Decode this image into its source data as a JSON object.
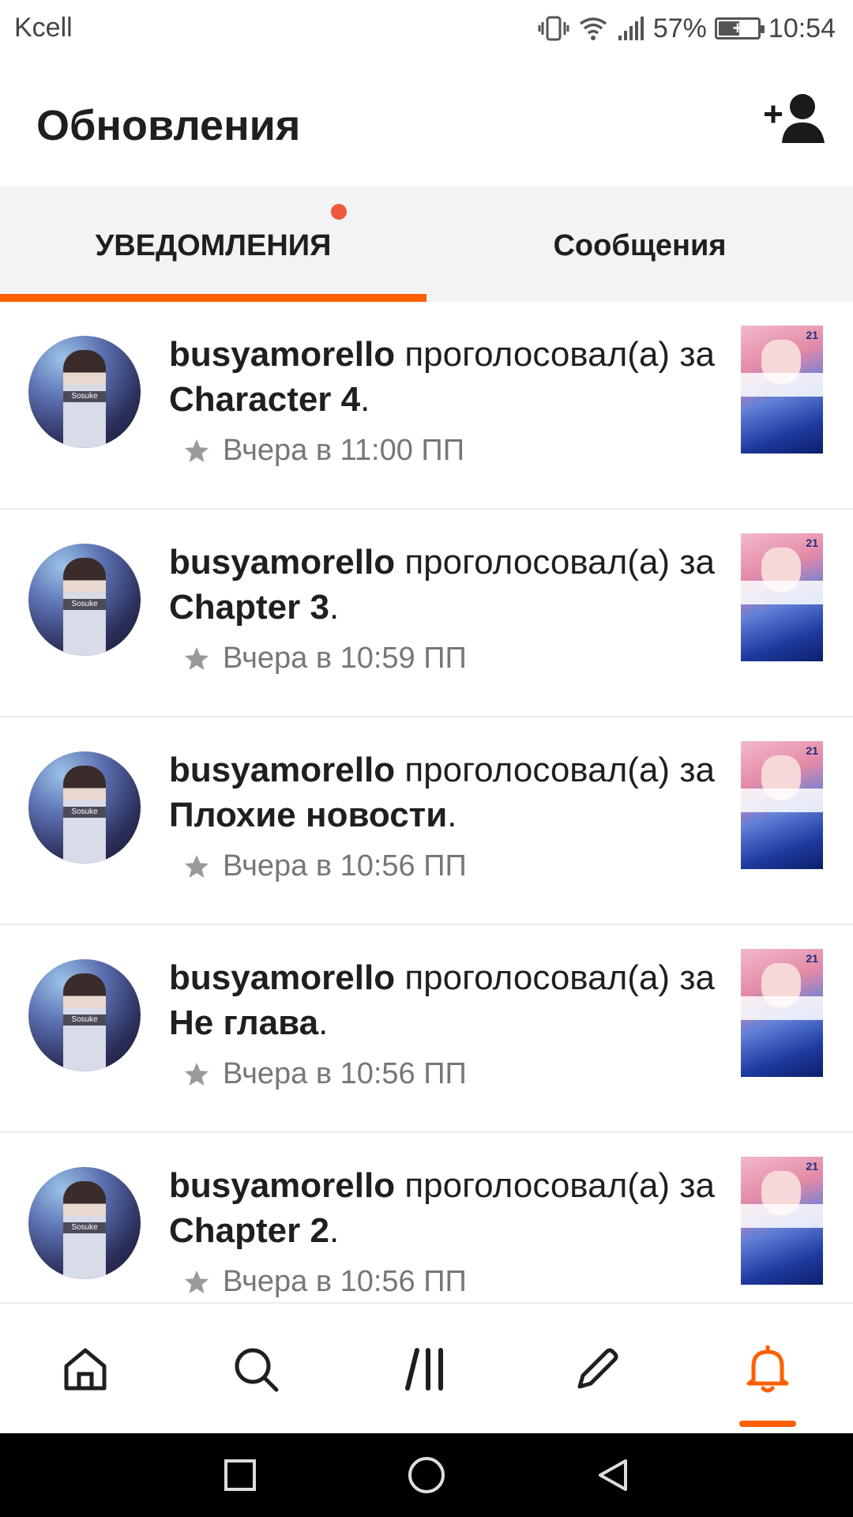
{
  "status_bar": {
    "carrier": "Kcell",
    "battery_percent": "57%",
    "battery_level": 0.57,
    "time": "10:54",
    "icons": [
      "vibrate-icon",
      "wifi-icon",
      "signal-icon",
      "battery-charging-icon"
    ]
  },
  "header": {
    "title": "Обновления",
    "action_icon": "add-user-icon"
  },
  "tabs": [
    {
      "label": "УВЕДОМЛЕНИЯ",
      "active": true,
      "has_badge": true
    },
    {
      "label": "Сообщения",
      "active": false,
      "has_badge": false
    }
  ],
  "notifications": [
    {
      "user": "busyamorello",
      "action": "проголосовал(а)",
      "prep": "за",
      "target": "Character 4",
      "end": ".",
      "time": "Вчера в 11:00 ПП",
      "avatar_label": "Sosuke",
      "cover_label": "21"
    },
    {
      "user": "busyamorello",
      "action": "проголосовал(а)",
      "prep": "за",
      "target": "Chapter 3",
      "end": ".",
      "time": "Вчера в 10:59 ПП",
      "avatar_label": "Sosuke",
      "cover_label": "21"
    },
    {
      "user": "busyamorello",
      "action": "проголосовал(а)",
      "prep": "за",
      "target": "Плохие новости",
      "end": ".",
      "time": "Вчера в 10:56 ПП",
      "avatar_label": "Sosuke",
      "cover_label": "21"
    },
    {
      "user": "busyamorello",
      "action": "проголосовал(а)",
      "prep": "за",
      "target": "Не глава",
      "end": ".",
      "time": "Вчера в 10:56 ПП",
      "avatar_label": "Sosuke",
      "cover_label": "21"
    },
    {
      "user": "busyamorello",
      "action": "проголосовал(а)",
      "prep": "за",
      "target": "Chapter 2",
      "end": ".",
      "time": "Вчера в 10:56 ПП",
      "avatar_label": "Sosuke",
      "cover_label": "21"
    }
  ],
  "bottom_nav": [
    {
      "icon": "home-icon",
      "active": false
    },
    {
      "icon": "search-icon",
      "active": false
    },
    {
      "icon": "library-icon",
      "active": false
    },
    {
      "icon": "write-icon",
      "active": false
    },
    {
      "icon": "bell-icon",
      "active": true
    }
  ],
  "system_nav": [
    "recent-apps-icon",
    "home-circle-icon",
    "back-icon"
  ],
  "colors": {
    "accent": "#ff5f00",
    "badge": "#f05a3a",
    "tab_bg": "#f3f3f5",
    "text": "#1f1f1f",
    "muted": "#777777"
  }
}
